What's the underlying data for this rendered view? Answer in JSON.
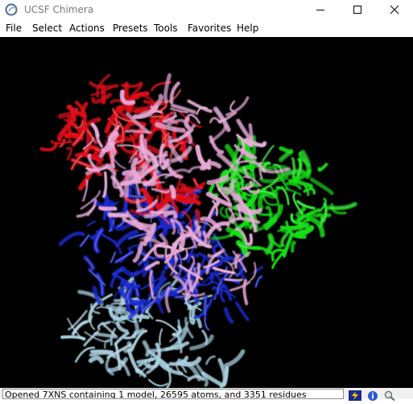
{
  "window": {
    "title": "UCSF Chimera",
    "icons": {
      "app": "chimera-logo-icon",
      "minimize": "minimize-icon",
      "maximize": "maximize-icon",
      "close": "close-icon"
    }
  },
  "menu": {
    "items": [
      {
        "label": "File"
      },
      {
        "label": "Select"
      },
      {
        "label": "Actions"
      },
      {
        "label": "Presets"
      },
      {
        "label": "Tools"
      },
      {
        "label": "Favorites"
      },
      {
        "label": "Help"
      }
    ]
  },
  "viewer": {
    "background": "#000000",
    "chain_colors": {
      "red": "#e0101a",
      "pink": "#e8a8d8",
      "green": "#18e018",
      "blue": "#1a2ad0",
      "light_blue": "#a8d0e0"
    }
  },
  "status": {
    "message": "Opened 7XNS containing 1 model, 26595 atoms, and 3351 residues",
    "icons": [
      "lightning-icon",
      "info-icon",
      "magnifier-icon"
    ]
  }
}
